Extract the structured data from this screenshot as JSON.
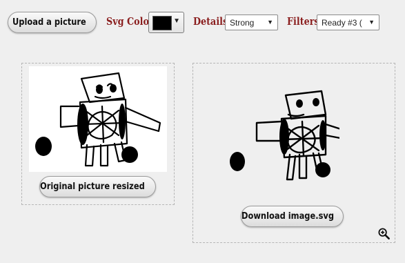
{
  "toolbar": {
    "upload_label": "Upload a picture",
    "svg_color_label": "Svg Color",
    "svg_color_value": "#000000",
    "details_label": "Details",
    "details_value": "Strong",
    "filters_label": "Filters",
    "filters_value": "Ready #3 ("
  },
  "left_panel": {
    "button_label": "Original picture resized",
    "button_icon": "image-icon"
  },
  "right_panel": {
    "button_label": "Download image.svg",
    "button_icon": "download-icon",
    "zoom_icon": "zoom-in-icon"
  },
  "colors": {
    "label_red": "#8a1e1e",
    "background": "#efefef"
  }
}
